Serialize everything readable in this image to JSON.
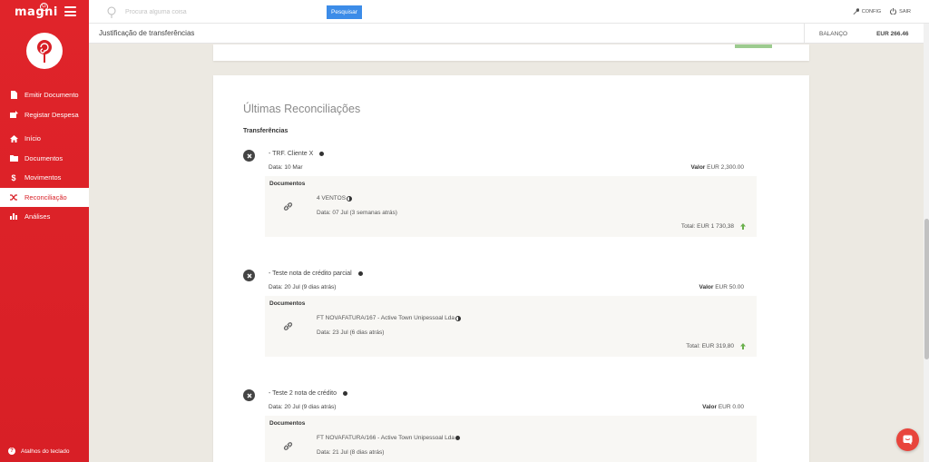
{
  "app": {
    "logo": "magni",
    "logo_sup": "G"
  },
  "sidebar": {
    "items": [
      {
        "label": "Emitir Documento",
        "icon": "file-icon"
      },
      {
        "label": "Registar Despesa",
        "icon": "expense-icon"
      },
      {
        "label": "Início",
        "icon": "home-icon"
      },
      {
        "label": "Documentos",
        "icon": "folder-icon"
      },
      {
        "label": "Movimentos",
        "icon": "dollar-icon"
      },
      {
        "label": "Reconciliação",
        "icon": "shuffle-icon",
        "active": true
      },
      {
        "label": "Análises",
        "icon": "bar-chart-icon"
      }
    ],
    "shortcuts_label": "Atalhos do teclado"
  },
  "topbar": {
    "search_placeholder": "Procura alguma coisa",
    "search_button": "Pesquisar",
    "config_label": "CONFIG",
    "logout_label": "SAIR"
  },
  "subheader": {
    "title": "Justificação de transferências",
    "balance_label": "BALANÇO",
    "balance_value": "EUR 266.46"
  },
  "main": {
    "card_title": "Últimas Reconciliações",
    "section_label": "Transferências",
    "transfers": [
      {
        "name": "- TRF. Cliente X",
        "date": "Data: 10 Mar",
        "valor_label": "Valor",
        "valor": "EUR 2,300.00",
        "docs_label": "Documentos",
        "doc_name": "4 VENTOS",
        "doc_status": "partial",
        "doc_date": "Data: 07 Jul (3 semanas atrás)",
        "total": "Total: EUR 1 730,38"
      },
      {
        "name": "- Teste nota de crédito parcial",
        "date": "Data: 20 Jul (9 dias atrás)",
        "valor_label": "Valor",
        "valor": "EUR 50.00",
        "docs_label": "Documentos",
        "doc_name": "FT NOVAFATURA/167 - Active Town Unipessoal Lda",
        "doc_status": "partial",
        "doc_date": "Data: 23 Jul (6 dias atrás)",
        "total": "Total: EUR 319,80"
      },
      {
        "name": "- Teste 2 nota de crédito",
        "date": "Data: 20 Jul (9 dias atrás)",
        "valor_label": "Valor",
        "valor": "EUR 0.00",
        "docs_label": "Documentos",
        "doc_name": "FT NOVAFATURA/166 - Active Town Unipessoal Lda",
        "doc_status": "full",
        "doc_date": "Data: 21 Jul (8 dias atrás)",
        "total": ""
      }
    ]
  },
  "colors": {
    "brand_red": "#d81f26",
    "search_blue": "#3c8ce8",
    "up_green": "#6ab04c"
  }
}
